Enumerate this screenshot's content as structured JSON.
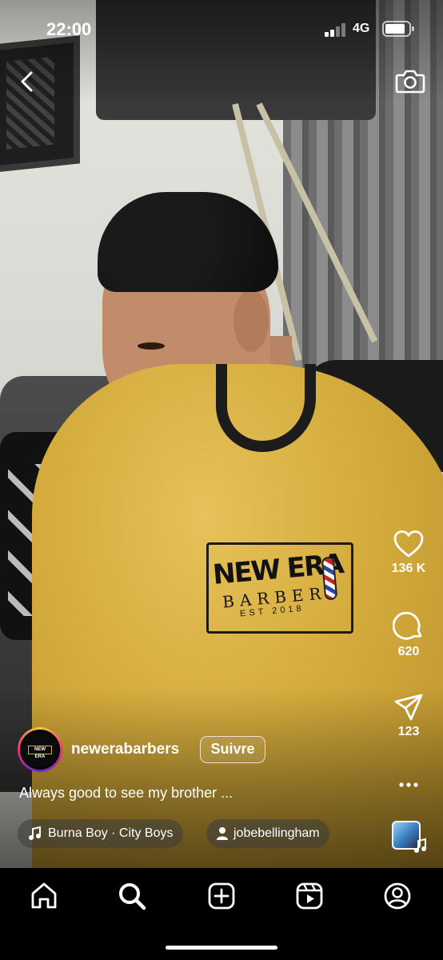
{
  "status_bar": {
    "time": "22:00",
    "network": "4G"
  },
  "top_bar": {
    "back_icon": "chevron-left-icon",
    "camera_icon": "camera-icon"
  },
  "post": {
    "logo_line1": "NEW ERA",
    "logo_line2": "BARBERS",
    "logo_line3": "EST 2018"
  },
  "actions": {
    "like_count": "136 K",
    "comment_count": "620",
    "share_count": "123",
    "more_icon": "more-horizontal-icon"
  },
  "author": {
    "username": "newerabarbers",
    "follow_label": "Suivre",
    "avatar_text": "NEW ERA",
    "story_ring_colors": [
      "#f9ce34",
      "#ee2a7b",
      "#6228d7"
    ]
  },
  "caption": "Always good to see my brother ...",
  "audio": {
    "track": "Burna Boy · City Boys",
    "tagged_user": "jobebellingham"
  },
  "bottom_nav": {
    "items": [
      "home-icon",
      "search-icon",
      "create-icon",
      "reels-icon",
      "profile-icon"
    ],
    "active": "search-icon"
  }
}
